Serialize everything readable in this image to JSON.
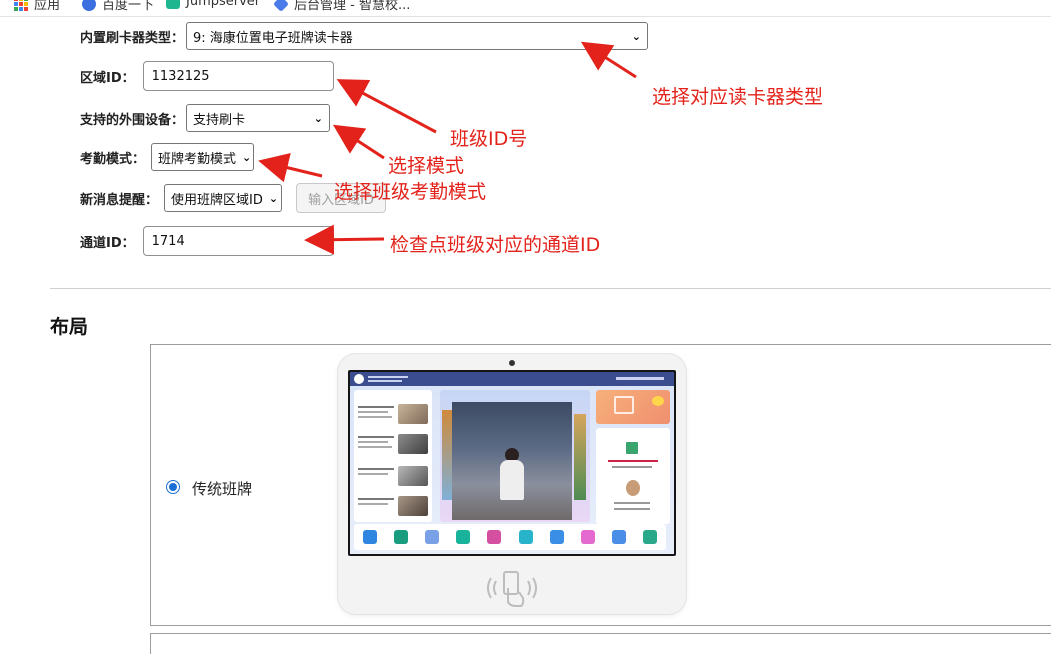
{
  "bookmarks": [
    {
      "label": "应用",
      "icon": "apps-grid-icon"
    },
    {
      "label": "百度一下",
      "icon": "baidu-paw-icon"
    },
    {
      "label": "Jumpserver",
      "icon": "jumpserver-icon"
    },
    {
      "label": "后台管理 - 智慧校...",
      "icon": "admin-icon"
    }
  ],
  "form": {
    "reader_type_label": "内置刷卡器类型：",
    "reader_type_value": "9: 海康位置电子班牌读卡器",
    "area_id_label": "区域ID：",
    "area_id_value": "1132125",
    "peripheral_label": "支持的外围设备：",
    "peripheral_value": "支持刷卡",
    "attendance_mode_label": "考勤模式：",
    "attendance_mode_value": "班牌考勤模式",
    "new_msg_label": "新消息提醒：",
    "new_msg_value": "使用班牌区域ID",
    "new_msg_button": "输入区域ID",
    "channel_id_label": "通道ID：",
    "channel_id_value": "1714"
  },
  "annotations": {
    "reader_type": "选择对应读卡器类型",
    "class_id": "班级ID号",
    "mode": "选择模式",
    "class_attendance": "选择班级考勤模式",
    "channel": "检查点班级对应的通道ID"
  },
  "annotation_color": "#e3231b",
  "layout_section": {
    "title": "布局",
    "option_label": "传统班牌",
    "option_selected": true
  }
}
